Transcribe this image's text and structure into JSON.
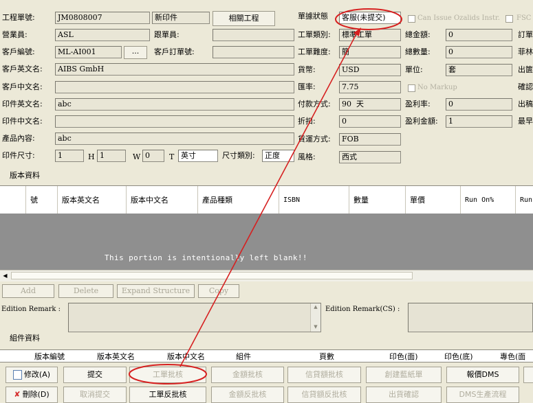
{
  "header": {
    "job_no_label": "工程單號:",
    "job_no_value": "JM0808007",
    "print_type_value": "新印件",
    "related_btn": "相關工程",
    "job_status_label": "單據狀態",
    "job_status_value": "客服(未提交)",
    "can_issue_label": "Can Issue Ozalids Instr.",
    "fsc_label": "FSC",
    "salesman_label": "營業員:",
    "salesman_value": "ASL",
    "follower_label": "跟單員:",
    "customer_code_label": "客戶編號:",
    "customer_code_value": "ML-AI001",
    "customer_order_label": "客戶訂單號:",
    "customer_en_label": "客戶英文名:",
    "customer_en_value": "AIBS GmbH",
    "customer_cn_label": "客戶中文名:",
    "print_en_label": "印件英文名:",
    "print_en_value": "abc",
    "print_cn_label": "印件中文名:",
    "product_label": "產品內容:",
    "product_value": "abc",
    "size_label": "印件尺寸:",
    "size_l": "1",
    "size_h_label": "H",
    "size_h": "1",
    "size_w_label": "W",
    "size_w": "0",
    "size_t_label": "T",
    "size_unit": "英寸",
    "size_type_label": "尺寸類別:",
    "size_type_value": "正度"
  },
  "right_panel": {
    "job_type_label": "工單類別:",
    "job_type_value": "標準工單",
    "difficulty_label": "工單難度:",
    "difficulty_value": "簡",
    "currency_label": "貨幣:",
    "currency_value": "USD",
    "rate_label": "匯率:",
    "rate_value": "7.75",
    "payment_label": "付款方式:",
    "payment_days": "90",
    "payment_unit": "天",
    "discount_label": "折扣:",
    "discount_value": "0",
    "shipping_label": "貨運方式:",
    "shipping_value": "FOB",
    "style_label": "風格:",
    "style_value": "西式",
    "total_amount_label": "總金額:",
    "total_amount_value": "0",
    "total_qty_label": "總數量:",
    "total_qty_value": "0",
    "unit_label": "單位:",
    "unit_value": "套",
    "no_markup_label": "No Markup",
    "profit_rate_label": "盈利率:",
    "profit_rate_value": "0",
    "profit_amount_label": "盈利金額:",
    "profit_amount_value": "1",
    "edge_labels": [
      "訂單",
      "菲林",
      "出篋",
      "確認",
      "出稿",
      "最早"
    ]
  },
  "edition": {
    "section_label": "版本資料",
    "columns": [
      "號",
      "版本英文名",
      "版本中文名",
      "產品種類",
      "ISBN",
      "數量",
      "單價",
      "Run On%",
      "Run"
    ],
    "blank_message": "This portion is intentionally left blank!!",
    "buttons": [
      "Add",
      "Delete",
      "Expand Structure",
      "Copy"
    ],
    "remark_label": "Edition Remark :",
    "remark_cs_label": "Edition Remark(CS) :"
  },
  "component": {
    "section_label": "組件資料",
    "columns": [
      "版本編號",
      "版本英文名",
      "版本中文名",
      "組件",
      "頁數",
      "印色(面)",
      "印色(底)",
      "專色(面"
    ]
  },
  "bottom_buttons": {
    "row1": [
      "修改(A)",
      "提交",
      "工單批核",
      "金額批核",
      "信貸額批核",
      "創建藍紙單",
      "報價DMS"
    ],
    "row2": [
      "刪除(D)",
      "取消提交",
      "工單反批核",
      "金額反批核",
      "信貸額反批核",
      "出貨確認",
      "DMS生產流程"
    ]
  },
  "annotation_color": "#d62020"
}
